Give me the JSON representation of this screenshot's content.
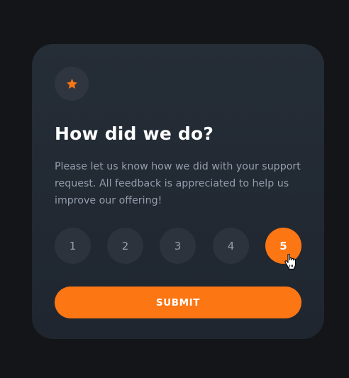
{
  "card": {
    "star_icon": "star-icon",
    "title": "How did we do?",
    "description": "Please let us know how we did with your support request. All feedback is appreciated to help us improve our offering!",
    "ratings": [
      "1",
      "2",
      "3",
      "4",
      "5"
    ],
    "selected_rating": "5",
    "submit_label": "SUBMIT",
    "cursor_icon": "pointer-hand-cursor-icon"
  },
  "colors": {
    "page_background": "#131518",
    "card_background": "#232a34",
    "accent_orange": "#fc7614",
    "rating_background": "#2c333d",
    "muted_text": "#959eac",
    "white": "#ffffff"
  }
}
